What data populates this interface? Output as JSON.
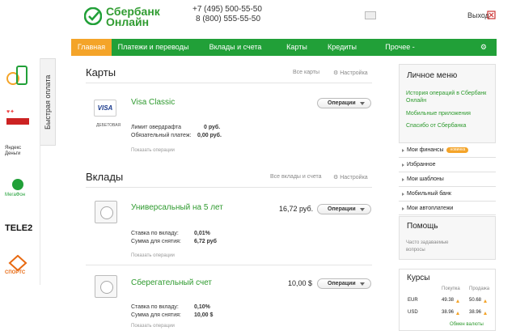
{
  "header": {
    "logo_line1": "Сбербанк",
    "logo_line2": "Онлайн",
    "phone1": "+7 (495) 500-55-50",
    "phone2": "8 (800) 555-55-50",
    "exit_label": "Выход"
  },
  "nav": {
    "items": [
      "Главная",
      "Платежи и переводы",
      "Вклады и счета",
      "Карты",
      "Кредиты",
      "Прочее -"
    ]
  },
  "left_panel": {
    "tab_label": "Быстрая оплата",
    "tele2": "TELE2",
    "megafon": "МегаФон",
    "yandex": "Яндекс Деньги",
    "sport": "СПОРТС"
  },
  "cards": {
    "title": "Карты",
    "all_link": "Все карты",
    "settings_link": "Настройка",
    "card_name": "Visa Classic",
    "card_type": "ДЕБЕТОВАЯ",
    "card_logo": "VISA",
    "ops_label": "Операции",
    "overdraft_label": "Лимит овердрафта",
    "overdraft_value": "0 руб.",
    "mandatory_label": "Обязательный платеж:",
    "mandatory_value": "0,00 руб.",
    "show_ops": "Показать операции"
  },
  "deposits": {
    "title": "Вклады",
    "all_link": "Все вклады и счета",
    "settings_link": "Настройка",
    "items": [
      {
        "name": "Универсальный на 5 лет",
        "amount": "16,72 руб.",
        "ops_label": "Операции",
        "rate_label": "Ставка по вкладу:",
        "rate_value": "0,01%",
        "withdraw_label": "Сумма для снятия:",
        "withdraw_value": "6,72 руб",
        "show_ops": "Показать операции"
      },
      {
        "name": "Сберегательный счет",
        "amount": "10,00 $",
        "ops_label": "Операции",
        "rate_label": "Ставка по вкладу:",
        "rate_value": "0,10%",
        "withdraw_label": "Сумма для снятия:",
        "withdraw_value": "10,00 $",
        "show_ops": "Показать операции"
      }
    ]
  },
  "right": {
    "menu_title": "Личное меню",
    "links": [
      "История операций в Сбербанк Онлайн",
      "Мобильные приложения",
      "Спасибо от Сбербанка"
    ],
    "menu_items": [
      "Мои финансы",
      "Избранное",
      "Мои шаблоны",
      "Мобильный банк",
      "Мои автоплатежи"
    ],
    "finance_badge": "новинка",
    "help_title": "Помощь",
    "help_link": "Часто задаваемые вопросы",
    "rates_title": "Курсы",
    "buy": "Покупка",
    "sell": "Продажа",
    "rates": [
      {
        "cur": "EUR",
        "buy": "49.38",
        "sell": "50.68"
      },
      {
        "cur": "USD",
        "buy": "38.96",
        "sell": "38.96"
      }
    ],
    "exchange_link": "Обмен валюты"
  },
  "colors": {
    "brand_green": "#21a038",
    "active_orange": "#f4a429",
    "link_green": "#2e9a2e"
  }
}
